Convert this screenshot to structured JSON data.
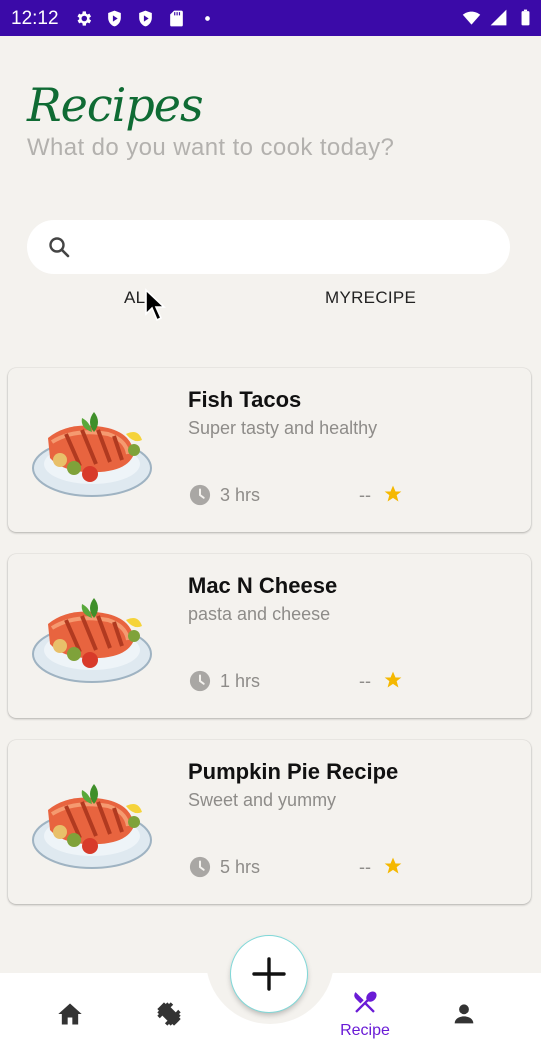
{
  "status_bar": {
    "time": "12:12",
    "left_icons": [
      "gear-icon",
      "shield-icon",
      "play-protect-icon",
      "sd-card-icon",
      "dot-icon"
    ],
    "right_icons": [
      "wifi-icon",
      "signal-icon",
      "battery-icon"
    ],
    "background": "#3b0aa8"
  },
  "header": {
    "title": "Recipes",
    "subtitle": "What do you want to cook today?",
    "title_color": "#0f6b34"
  },
  "search": {
    "value": "",
    "icon": "search-icon"
  },
  "tabs": [
    {
      "label": "ALL"
    },
    {
      "label": "MYRECIPE"
    }
  ],
  "recipes": [
    {
      "title": "Fish Tacos",
      "description": "Super tasty and healthy",
      "time": "3 hrs",
      "rating": "--"
    },
    {
      "title": "Mac N Cheese",
      "description": "pasta and cheese",
      "time": "1 hrs",
      "rating": "--"
    },
    {
      "title": "Pumpkin Pie Recipe",
      "description": "Sweet and yummy",
      "time": "5 hrs",
      "rating": "--"
    }
  ],
  "fab": {
    "icon": "plus-icon"
  },
  "bottom_nav": {
    "items": [
      {
        "icon": "home-icon",
        "label": ""
      },
      {
        "icon": "dumbbell-icon",
        "label": ""
      },
      {
        "icon": "fork-spoon-icon",
        "label": "Recipe",
        "active": true
      },
      {
        "icon": "person-icon",
        "label": ""
      }
    ],
    "active_color": "#6a1bd6"
  },
  "colors": {
    "background": "#f4f2ee",
    "star": "#f5b800",
    "accent": "#6a1bd6"
  }
}
